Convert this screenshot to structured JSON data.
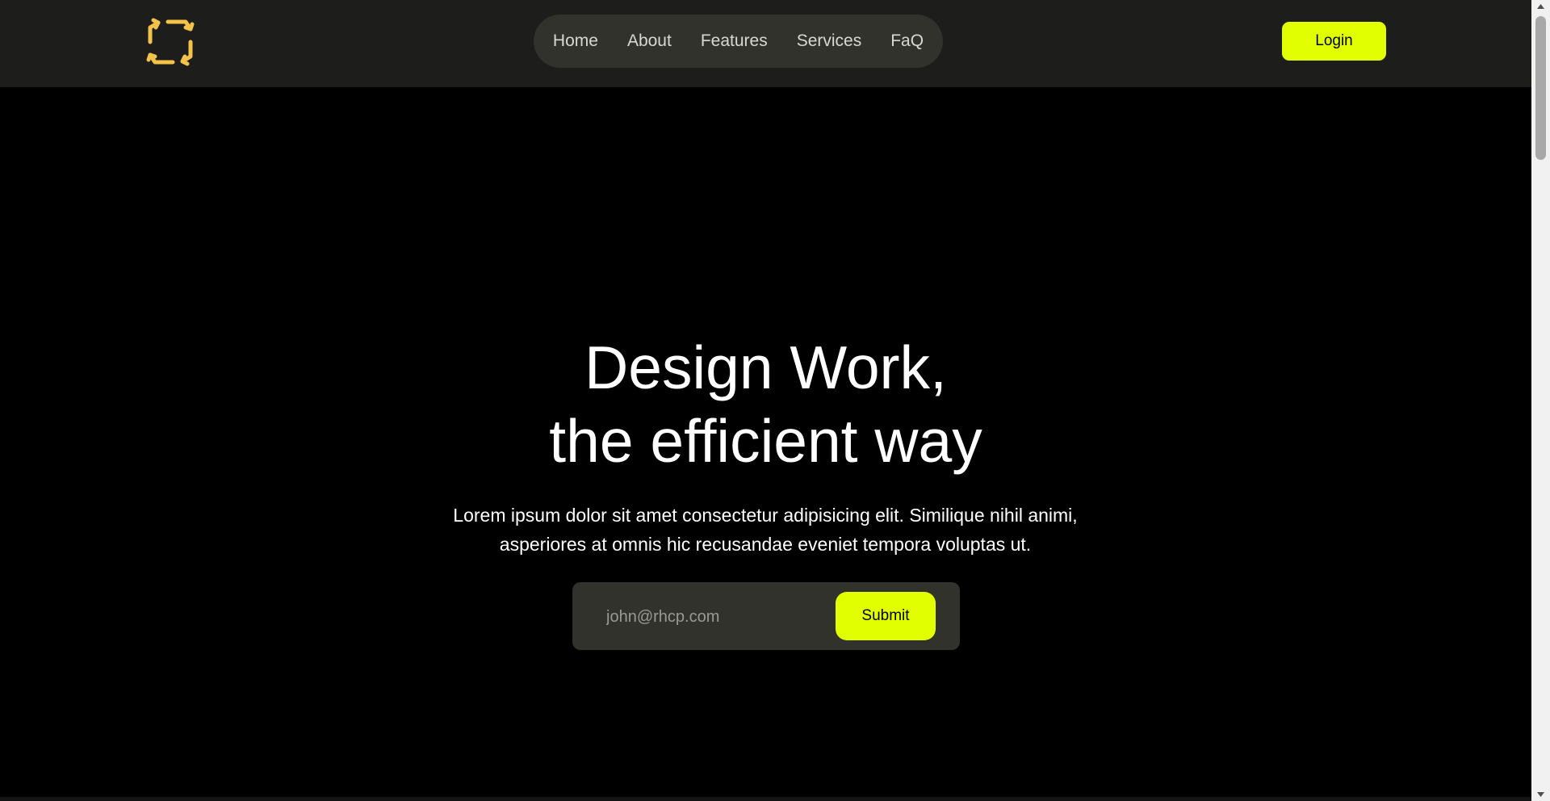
{
  "header": {
    "logo_icon": "rotate-arrows-icon",
    "logo_color": "#f2c24b",
    "nav": [
      {
        "label": "Home"
      },
      {
        "label": "About"
      },
      {
        "label": "Features"
      },
      {
        "label": "Services"
      },
      {
        "label": "FaQ"
      }
    ],
    "login_label": "Login"
  },
  "hero": {
    "title_line1": "Design Work,",
    "title_line2": "the efficient way",
    "subtitle": "Lorem ipsum dolor sit amet consectetur adipisicing elit. Similique nihil animi, asperiores at omnis hic recusandae eveniet tempora voluptas ut.",
    "email_placeholder": "john@rhcp.com",
    "submit_label": "Submit"
  },
  "colors": {
    "accent": "#e2ff00",
    "background": "#000000",
    "header_bg": "#1d1d1b",
    "pill_bg": "#31322b"
  }
}
